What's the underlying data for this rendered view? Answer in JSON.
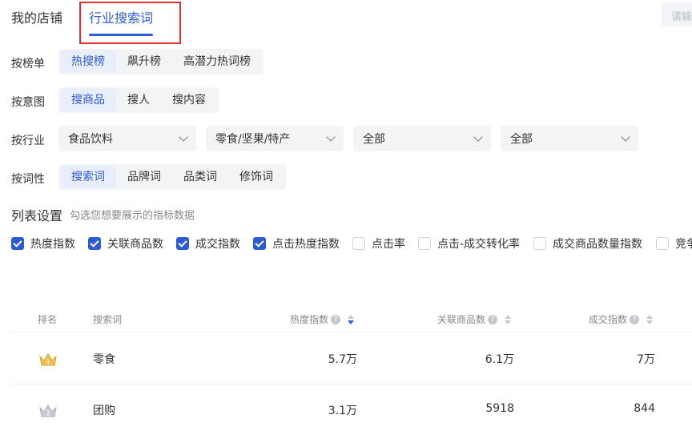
{
  "tabs": [
    {
      "label": "我的店铺",
      "active": false
    },
    {
      "label": "行业搜索词",
      "active": true
    }
  ],
  "search": {
    "placeholder": "请输"
  },
  "filters": {
    "rank_list": {
      "label": "按榜单",
      "options": [
        "热搜榜",
        "飙升榜",
        "高潜力热词榜"
      ],
      "selected": "热搜榜"
    },
    "intent": {
      "label": "按意图",
      "options": [
        "搜商品",
        "搜人",
        "搜内容"
      ],
      "selected": "搜商品"
    },
    "industry": {
      "label": "按行业",
      "selects": [
        "食品饮料",
        "零食/坚果/特产",
        "全部",
        "全部"
      ]
    },
    "word_type": {
      "label": "按词性",
      "options": [
        "搜索词",
        "品牌词",
        "品类词",
        "修饰词"
      ],
      "selected": "搜索词"
    }
  },
  "list_settings": {
    "title": "列表设置",
    "subtitle": "勾选您想要展示的指标数据",
    "checkboxes": [
      {
        "label": "热度指数",
        "checked": true
      },
      {
        "label": "关联商品数",
        "checked": true
      },
      {
        "label": "成交指数",
        "checked": true
      },
      {
        "label": "点击热度指数",
        "checked": true
      },
      {
        "label": "点击率",
        "checked": false
      },
      {
        "label": "点击-成交转化率",
        "checked": false
      },
      {
        "label": "成交商品数量指数",
        "checked": false
      },
      {
        "label": "竞争",
        "checked": false
      }
    ]
  },
  "table": {
    "headers": {
      "rank": "排名",
      "keyword": "搜索词",
      "heat": "热度指数",
      "products": "关联商品数",
      "deal": "成交指数"
    },
    "rows": [
      {
        "rank": "1",
        "keyword": "零食",
        "heat": "5.7万",
        "products": "6.1万",
        "deal": "7万"
      },
      {
        "rank": "2",
        "keyword": "团购",
        "heat": "3.1万",
        "products": "5918",
        "deal": "844"
      }
    ]
  },
  "colors": {
    "accent": "#2d5bd8",
    "highlight_box": "#e5302f",
    "gold": "#f2c14e",
    "silver": "#c9cdd3"
  }
}
